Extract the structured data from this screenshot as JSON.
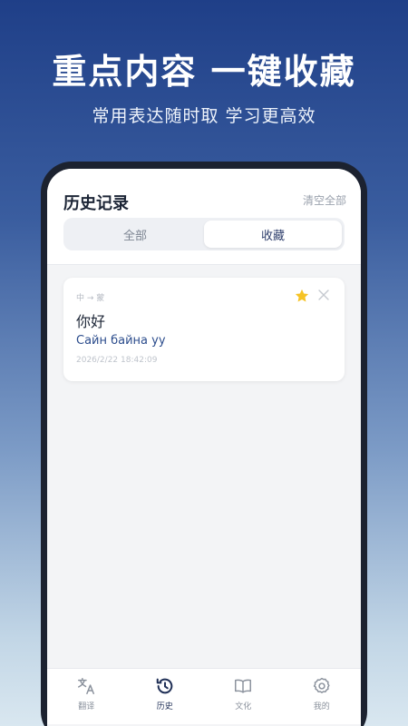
{
  "hero": {
    "title": "重点内容 一键收藏",
    "subtitle": "常用表达随时取 学习更高效"
  },
  "header": {
    "title": "历史记录",
    "clear_label": "清空全部"
  },
  "segments": [
    {
      "label": "全部",
      "active": false
    },
    {
      "label": "收藏",
      "active": true
    }
  ],
  "records": [
    {
      "direction": "中 → 蒙",
      "source": "你好",
      "target": "Сайн байна уу",
      "time": "2026/2/22 18:42:09",
      "starred": true
    }
  ],
  "tabbar": [
    {
      "label": "翻译",
      "icon": "translate-icon",
      "active": false
    },
    {
      "label": "历史",
      "icon": "history-icon",
      "active": true
    },
    {
      "label": "文化",
      "icon": "book-icon",
      "active": false
    },
    {
      "label": "我的",
      "icon": "gear-icon",
      "active": false
    }
  ],
  "colors": {
    "accent": "#1f2f56",
    "star": "#f6c325",
    "target_text": "#2b4c8c"
  }
}
